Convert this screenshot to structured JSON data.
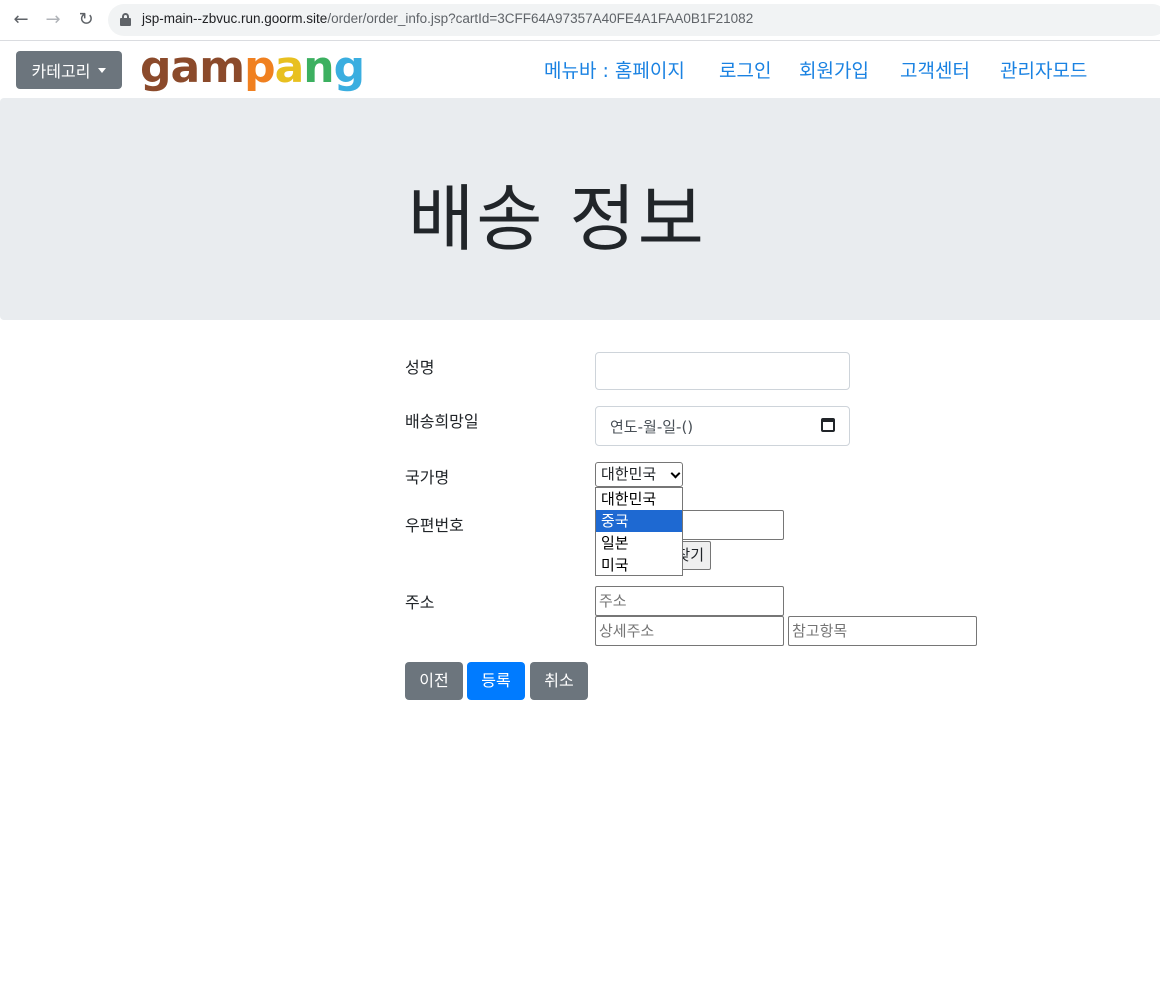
{
  "browser": {
    "url_host": "jsp-main--zbvuc.run.goorm.site",
    "url_path": "/order/order_info.jsp?cartId=3CFF64A97357A40FE4A1FAA0B1F21082"
  },
  "navbar": {
    "category_button": "카테고리",
    "logo_letters": [
      "g",
      "a",
      "m",
      "p",
      "a",
      "n",
      "g"
    ],
    "logo_colors": [
      "#8b4a2b",
      "#8b4a2b",
      "#8b4a2b",
      "#f08020",
      "#e8c020",
      "#3cb060",
      "#3aaee0"
    ],
    "menu": [
      "메뉴바 : 홈페이지",
      "로그인",
      "회원가입",
      "고객센터",
      "관리자모드"
    ]
  },
  "jumbotron": {
    "title": "배송 정보"
  },
  "form": {
    "name_label": "성명",
    "date_label": "배송희망일",
    "date_placeholder": "연도-월-일-()",
    "country_label": "국가명",
    "country_selected": "대한민국",
    "country_options": [
      "대한민국",
      "중국",
      "일본",
      "미국"
    ],
    "country_highlighted": "중국",
    "zip_label": "우편번호",
    "zip_button_visible_text": "찾기",
    "address_label": "주소",
    "address_placeholder": "주소",
    "address_detail_placeholder": "상세주소",
    "address_extra_placeholder": "참고항목"
  },
  "buttons": {
    "prev": "이전",
    "submit": "등록",
    "cancel": "취소"
  },
  "colors": {
    "primary": "#007bff",
    "secondary": "#6c757d",
    "jumbotron_bg": "#e9ecef",
    "link": "#1a82e2"
  }
}
